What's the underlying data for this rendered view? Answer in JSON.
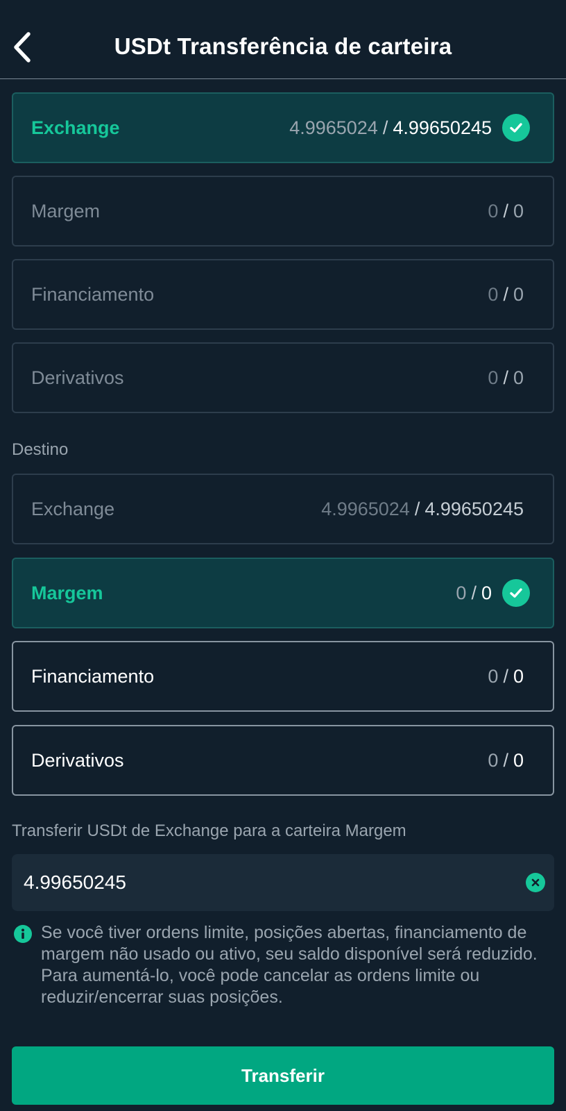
{
  "header": {
    "title": "USDt Transferência de carteira"
  },
  "origin_wallets": [
    {
      "name": "Exchange",
      "available": "4.9965024",
      "total": "4.99650245",
      "selected": true
    },
    {
      "name": "Margem",
      "available": "0",
      "total": "0",
      "selected": false
    },
    {
      "name": "Financiamento",
      "available": "0",
      "total": "0",
      "selected": false
    },
    {
      "name": "Derivativos",
      "available": "0",
      "total": "0",
      "selected": false
    }
  ],
  "destination": {
    "label": "Destino",
    "wallets": [
      {
        "name": "Exchange",
        "available": "4.9965024",
        "total": "4.99650245",
        "selected": false
      },
      {
        "name": "Margem",
        "available": "0",
        "total": "0",
        "selected": true
      },
      {
        "name": "Financiamento",
        "available": "0",
        "total": "0",
        "selected": false
      },
      {
        "name": "Derivativos",
        "available": "0",
        "total": "0",
        "selected": false
      }
    ]
  },
  "separator": "/",
  "transfer": {
    "label": "Transferir USDt de Exchange para a carteira Margem",
    "amount": "4.99650245",
    "info": "Se você tiver ordens limite, posições abertas, financiamento de margem não usado ou ativo, seu saldo disponível será reduzido. Para aumentá-lo, você pode cancelar as ordens limite ou reduzir/encerrar suas posições.",
    "button_label": "Transferir"
  },
  "colors": {
    "background": "#111f2c",
    "accent": "#16c79a",
    "button": "#01a781",
    "selected_bg": "#0d3c43"
  },
  "icons": {
    "back": "chevron-left-icon",
    "selected": "check-circle-icon",
    "clear": "clear-circle-icon",
    "info": "info-circle-icon"
  }
}
